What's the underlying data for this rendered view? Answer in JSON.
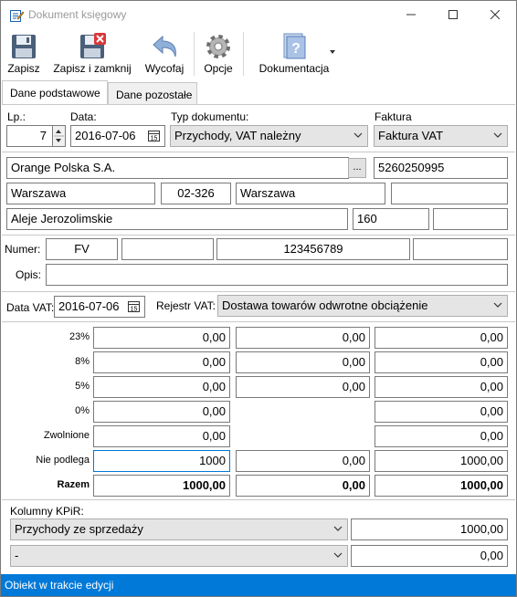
{
  "window": {
    "title": "Dokument księgowy",
    "minimize": "—",
    "maximize": "☐",
    "close": "✕"
  },
  "toolbar": {
    "save_label": "Zapisz",
    "save_close_label": "Zapisz i zamknij",
    "undo_label": "Wycofaj",
    "options_label": "Opcje",
    "docs_label": "Dokumentacja"
  },
  "tabs": [
    {
      "label": "Dane podstawowe"
    },
    {
      "label": "Dane pozostałe"
    }
  ],
  "header": {
    "lp_label": "Lp.:",
    "lp_value": "7",
    "date_label": "Data:",
    "date_value": "2016-07-06",
    "doc_type_label": "Typ dokumentu:",
    "doc_type_value": "Przychody, VAT należny",
    "invoice_label": "Faktura",
    "invoice_value": "Faktura VAT"
  },
  "contractor": {
    "name": "Orange Polska S.A.",
    "browse": "...",
    "nip": "5260250995",
    "city1": "Warszawa",
    "postcode": "02-326",
    "city2": "Warszawa",
    "extra": "",
    "street": "Aleje Jerozolimskie",
    "building": "160",
    "apartment": ""
  },
  "number": {
    "label": "Numer:",
    "prefix": "FV",
    "part2": "",
    "value": "123456789",
    "suffix": ""
  },
  "description": {
    "label": "Opis:",
    "value": ""
  },
  "vat": {
    "date_label": "Data VAT:",
    "date_value": "2016-07-06",
    "register_label": "Rejestr VAT:",
    "register_value": "Dostawa towarów odwrotne obciążenie"
  },
  "rates": [
    {
      "label": "23%",
      "net": "0,00",
      "vat": "0,00",
      "gross": "0,00"
    },
    {
      "label": "8%",
      "net": "0,00",
      "vat": "0,00",
      "gross": "0,00"
    },
    {
      "label": "5%",
      "net": "0,00",
      "vat": "0,00",
      "gross": "0,00"
    },
    {
      "label": "0%",
      "net": "0,00",
      "vat": null,
      "gross": "0,00"
    },
    {
      "label": "Zwolnione",
      "net": "0,00",
      "vat": null,
      "gross": "0,00"
    },
    {
      "label": "Nie podlega",
      "net": "1000",
      "vat": "0,00",
      "gross": "1000,00"
    },
    {
      "label": "Razem",
      "net": "1000,00",
      "vat": "0,00",
      "gross": "1000,00"
    }
  ],
  "kpir": {
    "label": "Kolumny KPiR:",
    "rows": [
      {
        "column": "Przychody ze sprzedaży",
        "amount": "1000,00"
      },
      {
        "column": "-",
        "amount": "0,00"
      }
    ]
  },
  "status": {
    "text": "Obiekt w trakcie edycji"
  },
  "colors": {
    "status_bar": "#0079d8",
    "focus": "#0078d7",
    "combo_bg": "#e5e5e5"
  }
}
